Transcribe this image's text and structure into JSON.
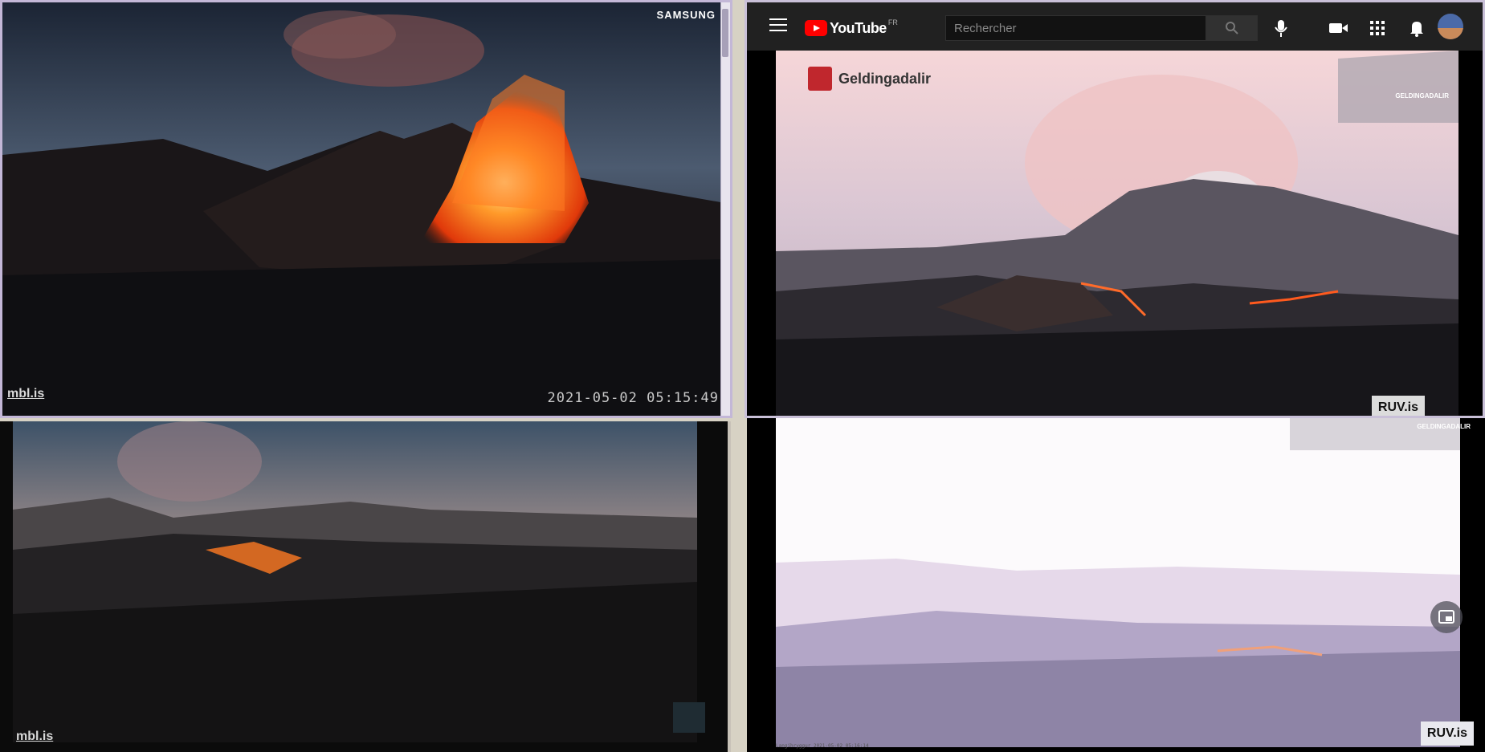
{
  "pane1": {
    "brand": "SAMSUNG",
    "watermark": "mbl.is",
    "timestamp": "2021-05-02 05:15:49"
  },
  "youtube": {
    "logo_text": "YouTube",
    "region": "FR",
    "search_placeholder": "Rechercher",
    "video_title": "Geldingadalir",
    "map_label": "GELDINGADALIR",
    "watermark": "RUV.is",
    "icons": [
      "menu-icon",
      "search-icon",
      "mic-icon",
      "create-video-icon",
      "apps-grid-icon",
      "bell-icon",
      "avatar"
    ]
  },
  "pane3": {
    "watermark": "mbl.is"
  },
  "pane4": {
    "map_label": "GELDINGADALIR",
    "watermark": "RUV.is",
    "caption": "Langihryggur 2021-05-02 05:16:14",
    "icons": [
      "picture-in-picture-icon"
    ]
  }
}
